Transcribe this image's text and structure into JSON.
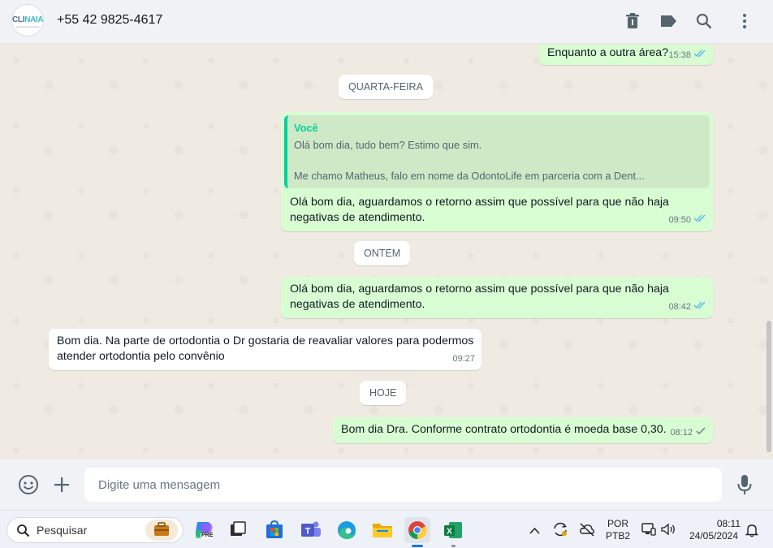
{
  "header": {
    "contact_name": "+55 42 9825-4617",
    "avatar_logo_prefix": "CLI",
    "avatar_logo_suffix": "NAIA",
    "avatar_logo_sub": "odontologia integrada"
  },
  "messages": {
    "m1": {
      "text": "Enquanto a outra área?",
      "time": "15:38"
    },
    "date1": "QUARTA-FEIRA",
    "m2": {
      "quote_author": "Você",
      "quote_line1": "Olá bom dia, tudo bem? Estimo que sim.",
      "quote_line2": "Me chamo Matheus, falo em nome da OdontoLife em parceria com a Dent...",
      "text": "Olá bom dia, aguardamos o retorno assim que possível para que não haja negativas de atendimento.",
      "time": "09:50"
    },
    "date2": "ONTEM",
    "m3": {
      "text": "Olá bom dia, aguardamos o retorno assim que possível para que não haja negativas de atendimento.",
      "time": "08:42"
    },
    "m4": {
      "text": "Bom dia. Na parte de ortodontia o Dr gostaria de reavaliar valores para podermos atender ortodontia pelo convênio",
      "time": "09:27"
    },
    "date3": "HOJE",
    "m5": {
      "text": "Bom dia Dra. Conforme contrato ortodontia é moeda base 0,30.",
      "time": "08:12"
    }
  },
  "composer": {
    "placeholder": "Digite uma mensagem"
  },
  "taskbar": {
    "search_label": "Pesquisar",
    "lang_line1": "POR",
    "lang_line2": "PTB2",
    "clock_time": "08:11",
    "clock_date": "24/05/2024",
    "copilot_badge": "PRE"
  },
  "colors": {
    "outgoing_bubble": "#d9fdd3",
    "incoming_bubble": "#ffffff",
    "read_ticks": "#53bdeb",
    "quote_accent": "#06cf9c"
  }
}
